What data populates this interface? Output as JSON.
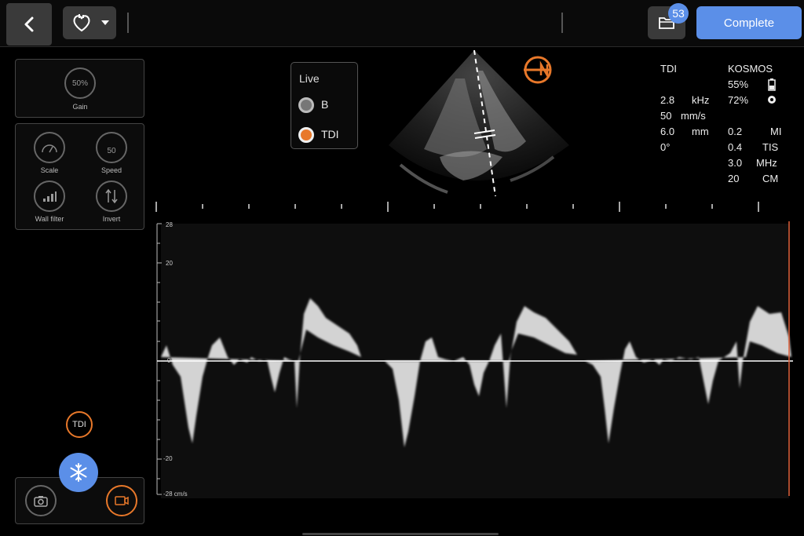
{
  "topbar": {
    "back_icon": "chevron-left-icon",
    "preset_icon": "heart-icon",
    "dropdown_icon": "caret-down-icon",
    "folder_icon": "folder-icon",
    "study_count": "53",
    "complete_label": "Complete"
  },
  "controls": {
    "gain_value": "50%",
    "gain_label": "Gain",
    "scale_label": "Scale",
    "speed_value": "50",
    "speed_label": "Speed",
    "wall_filter_label": "Wall filter",
    "invert_label": "Invert"
  },
  "live": {
    "title": "Live",
    "options": [
      "B",
      "TDI"
    ],
    "selected": "TDI"
  },
  "info_left": {
    "mode": "TDI",
    "freq_value": "2.8",
    "freq_unit": "kHz",
    "sweep_value": "50",
    "sweep_unit": "mm/s",
    "gate_value": "6.0",
    "gate_unit": "mm",
    "angle": "0°"
  },
  "info_right": {
    "device": "KOSMOS",
    "battery": "55%",
    "other_battery": "72%",
    "mi_value": "0.2",
    "mi_unit": "MI",
    "tis_value": "0.4",
    "tis_unit": "TIS",
    "mhz_value": "3.0",
    "mhz_unit": "MHz",
    "depth_value": "20",
    "depth_unit": "CM"
  },
  "scale": {
    "top": "28",
    "p20": "20",
    "zero": "0",
    "m20": "-20",
    "bottom": "-28 cm/s"
  },
  "tdi_badge": "TDI",
  "freeze_icon": "snowflake-icon",
  "camera_icon": "camera-icon",
  "video_icon": "video-record-icon"
}
